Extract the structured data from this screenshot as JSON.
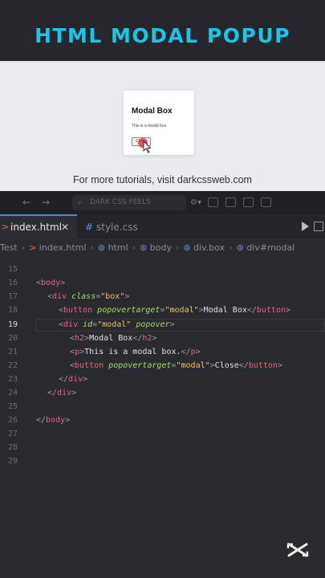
{
  "banner": {
    "title": "HTML MODAL POPUP"
  },
  "preview": {
    "card_title": "Modal Box",
    "card_text": "This is a modal box.",
    "card_button": "Close",
    "tutorial_note": "For more tutorials, visit darkcssweb.com"
  },
  "titlebar": {
    "command_center": "DARK CSS FEELS"
  },
  "tabs": [
    {
      "label": "index.html",
      "active": true
    },
    {
      "label": "style.css",
      "active": false
    }
  ],
  "breadcrumb": [
    "Test",
    "index.html",
    "html",
    "body",
    "div.box",
    "div#modal"
  ],
  "code": {
    "active_line": 19,
    "lines": [
      {
        "num": "15"
      },
      {
        "num": "16"
      },
      {
        "num": "17"
      },
      {
        "num": "18"
      },
      {
        "num": "19"
      },
      {
        "num": "20"
      },
      {
        "num": "21"
      },
      {
        "num": "22"
      },
      {
        "num": "23"
      },
      {
        "num": "24"
      },
      {
        "num": "25"
      },
      {
        "num": "26"
      },
      {
        "num": "27"
      },
      {
        "num": "28"
      },
      {
        "num": "29"
      }
    ],
    "tokens": {
      "l16": [
        "<",
        "body",
        ">"
      ],
      "l17": [
        "<",
        "div",
        " class",
        "=",
        "\"box\"",
        ">"
      ],
      "l18": [
        "<",
        "button",
        " popovertarget",
        "=",
        "\"modal\"",
        ">",
        "Modal Box",
        "</",
        "button",
        ">"
      ],
      "l19": [
        "<",
        "div",
        " id",
        "=",
        "\"modal\"",
        " popover",
        ">"
      ],
      "l20": [
        "<",
        "h2",
        ">",
        "Modal Box",
        "</",
        "h2",
        ">"
      ],
      "l21": [
        "<",
        "p",
        ">",
        "This is a modal box.",
        "</",
        "p",
        ">"
      ],
      "l22": [
        "<",
        "button",
        " popovertarget",
        "=",
        "\"modal\"",
        ">",
        "Close",
        "</",
        "button",
        ">"
      ],
      "l23": [
        "</",
        "div",
        ">"
      ],
      "l24": [
        "</",
        "div",
        ">"
      ],
      "l26": [
        "</",
        "body",
        ">"
      ]
    }
  },
  "colors": {
    "title_accent": "#19c6e6",
    "tag": "#e0667f",
    "attribute": "#a6d96a",
    "value": "#e8c173"
  }
}
